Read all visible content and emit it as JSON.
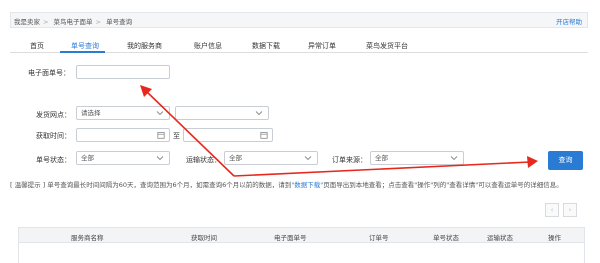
{
  "header": {
    "breadcrumb": [
      "我是卖家",
      "菜鸟电子面单",
      "单号查询"
    ],
    "help_link": "开店帮助"
  },
  "tabs": [
    "首页",
    "单号查询",
    "我的服务商",
    "账户信息",
    "数据下载",
    "异常订单",
    "菜鸟发货平台"
  ],
  "form": {
    "waybill_label": "电子面单号：",
    "ship_point_label": "发货网点：",
    "ship_point_select": "请选择",
    "time_label": "获取时间：",
    "to_label": "至",
    "status_label": "单号状态：",
    "status_value": "全部",
    "transport_label": "运输状态：",
    "transport_value": "全部",
    "source_label": "订单来源：",
    "source_value": "全部",
    "query_button": "查询"
  },
  "tip": {
    "text_before": "[ 温馨提示 ] 单号查询最长时间间隔为60天，查询范围为6个月，如需查询6个月以前的数据，请到",
    "link": "\"数据下载\"",
    "text_after": "页面导出到本地查看；点击查看\"操作\"列的\"查看详情\"可以查看运单号的详细信息。"
  },
  "pager": {
    "prev": "‹",
    "next": "›"
  },
  "table": {
    "columns": [
      "服务商名称",
      "获取时间",
      "电子面单号",
      "订单号",
      "单号状态",
      "运输状态",
      "操作"
    ]
  },
  "colors": {
    "accent": "#2a7bd4",
    "annotation": "#e8271d"
  }
}
